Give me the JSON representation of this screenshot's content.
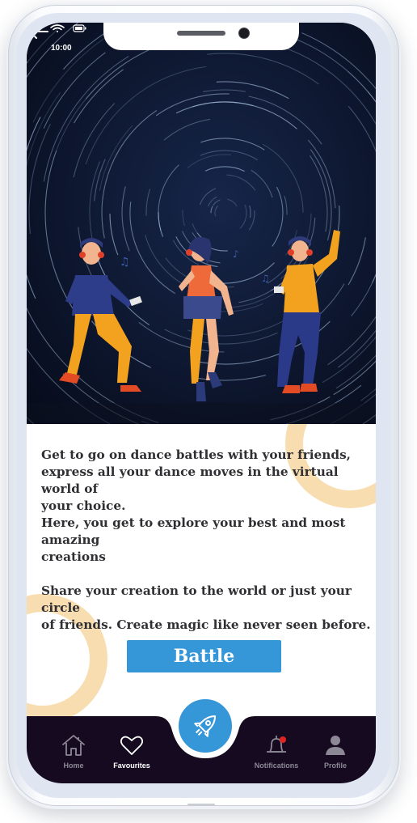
{
  "status_bar": {
    "time": "10:00"
  },
  "hero": {
    "illustration": "three dancers with headphones under star-trail night sky"
  },
  "content": {
    "paragraph1_lines": [
      "Get to go on dance battles with your friends,",
      "express all your  dance moves in the virtual world of",
      "your choice.",
      "Here, you get to explore your best and most amazing",
      "creations"
    ],
    "paragraph2_lines": [
      "Share your creation to the world or just your circle",
      "of friends. Create magic like never seen before."
    ]
  },
  "actions": {
    "battle_label": "Battle"
  },
  "nav": {
    "items": [
      {
        "label": "Home",
        "icon": "home-icon",
        "active": false
      },
      {
        "label": "Favourites",
        "icon": "heart-icon",
        "active": true
      },
      {
        "label": "Notifications",
        "icon": "bell-icon",
        "active": false
      },
      {
        "label": "Profile",
        "icon": "user-icon",
        "active": false
      }
    ],
    "fab_icon": "rocket-icon"
  },
  "colors": {
    "accent": "#3596d8",
    "nav_background": "#150a1f",
    "ring": "#f8ddb0",
    "notification_dot": "#e02323"
  }
}
